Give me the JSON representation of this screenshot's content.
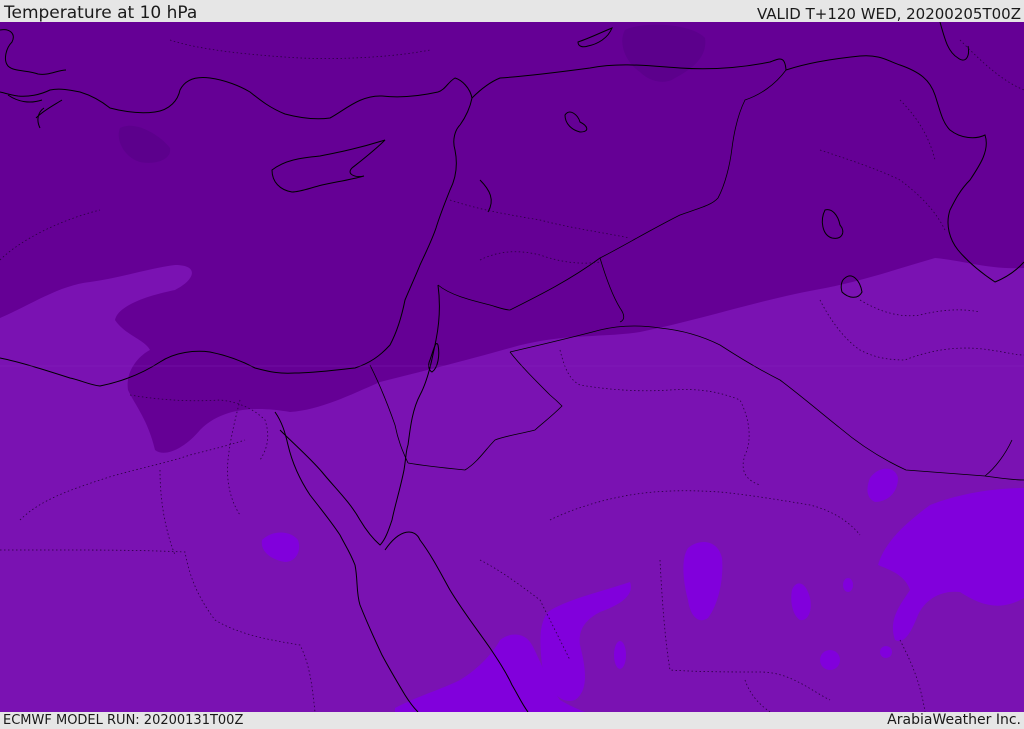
{
  "header": {
    "title": "Temperature at 10 hPa",
    "valid": "VALID T+120 WED, 20200205T00Z"
  },
  "footer": {
    "model_run": "ECMWF MODEL RUN: 20200131T00Z",
    "credit": "ArabiaWeather Inc."
  },
  "map": {
    "region": "Eastern Mediterranean and Arabian Peninsula",
    "shading_colors": {
      "darkest": "#5c008c",
      "dark": "#650095",
      "mid": "#7a12b2",
      "bright": "#8100dc"
    },
    "coastline_color": "#000000"
  }
}
